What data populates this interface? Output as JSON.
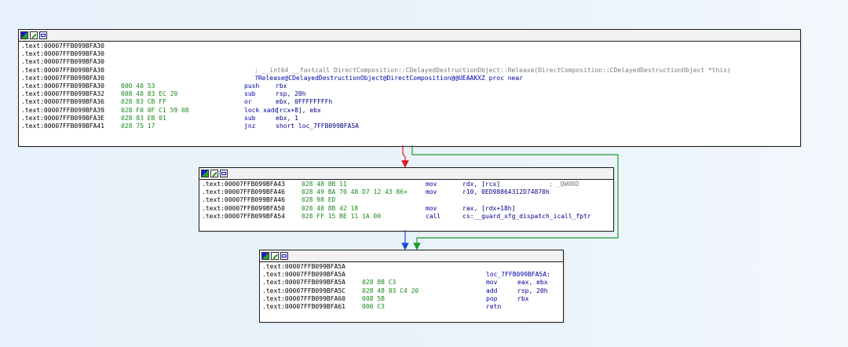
{
  "colors": {
    "background": "#e6f1fb",
    "edge_true": "#1f9a2e",
    "edge_false": "#e21a1a",
    "edge_uncond": "#1a4ad8"
  },
  "node_header_icons": [
    "color-picker-icon",
    "edit-node-icon",
    "graph-overview-icon"
  ],
  "blocks": [
    {
      "lines": [
        {
          "addr": ".text:00007FFB099BFA30",
          "bytes": "",
          "mnem": "",
          "ops": "",
          "comment": ""
        },
        {
          "addr": ".text:00007FFB099BFA30",
          "bytes": "",
          "mnem": "",
          "ops": "",
          "comment": ""
        },
        {
          "addr": ".text:00007FFB099BFA30",
          "bytes": "",
          "mnem": "",
          "ops": "",
          "comment": ""
        },
        {
          "addr": ".text:00007FFB099BFA30",
          "bytes": "",
          "mnem": "",
          "ops": "",
          "comment": "; __int64 __fastcall DirectComposition::CDelayedDestructionObject::Release(DirectComposition::CDelayedDestructionObject *this)"
        },
        {
          "addr": ".text:00007FFB099BFA30",
          "bytes": "",
          "mnem": "",
          "ops": "",
          "comment": "",
          "name": "?Release@CDelayedDestructionObject@DirectComposition@@UEAAKXZ proc near"
        },
        {
          "addr": ".text:00007FFB099BFA30",
          "bytes": "000 40 53",
          "mnem": "push",
          "ops": "rbx",
          "comment": ""
        },
        {
          "addr": ".text:00007FFB099BFA32",
          "bytes": "008 48 83 EC 20",
          "mnem": "sub",
          "ops": "rsp, 20h",
          "comment": ""
        },
        {
          "addr": ".text:00007FFB099BFA36",
          "bytes": "028 83 CB FF",
          "mnem": "or",
          "ops": "ebx, 0FFFFFFFFh",
          "comment": ""
        },
        {
          "addr": ".text:00007FFB099BFA39",
          "bytes": "028 F0 0F C1 59 08",
          "mnem": "lock xadd",
          "ops": "[rcx+8], ebx",
          "comment": ""
        },
        {
          "addr": ".text:00007FFB099BFA3E",
          "bytes": "028 83 EB 01",
          "mnem": "sub",
          "ops": "ebx, 1",
          "comment": ""
        },
        {
          "addr": ".text:00007FFB099BFA41",
          "bytes": "028 75 17",
          "mnem": "jnz",
          "ops": "short loc_7FFB099BFA5A",
          "comment": ""
        }
      ]
    },
    {
      "lines": [
        {
          "addr": ".text:00007FFB099BFA43",
          "bytes": "028 48 8B 11",
          "mnem": "mov",
          "ops": "rdx, [rcx]",
          "comment": "; _QWORD"
        },
        {
          "addr": ".text:00007FFB099BFA46",
          "bytes": "028 49 BA 70 48 D7 12 43 86+",
          "mnem": "mov",
          "ops": "r10, 0ED98864312D74870h",
          "comment": ""
        },
        {
          "addr": ".text:00007FFB099BFA46",
          "bytes": "028 98 ED",
          "mnem": "",
          "ops": "",
          "comment": ""
        },
        {
          "addr": ".text:00007FFB099BFA50",
          "bytes": "028 48 8B 42 18",
          "mnem": "mov",
          "ops": "rax, [rdx+18h]",
          "comment": ""
        },
        {
          "addr": ".text:00007FFB099BFA54",
          "bytes": "028 FF 15 BE 11 1A 00",
          "mnem": "call",
          "ops": "cs:__guard_xfg_dispatch_icall_fptr",
          "comment": ""
        }
      ]
    },
    {
      "lines": [
        {
          "addr": ".text:00007FFB099BFA5A",
          "bytes": "",
          "mnem": "",
          "ops": "",
          "comment": ""
        },
        {
          "addr": ".text:00007FFB099BFA5A",
          "bytes": "",
          "mnem": "",
          "ops": "",
          "comment": "",
          "name": "loc_7FFB099BFA5A:"
        },
        {
          "addr": ".text:00007FFB099BFA5A",
          "bytes": "028 8B C3",
          "mnem": "mov",
          "ops": "eax, ebx",
          "comment": ""
        },
        {
          "addr": ".text:00007FFB099BFA5C",
          "bytes": "028 48 83 C4 20",
          "mnem": "add",
          "ops": "rsp, 20h",
          "comment": ""
        },
        {
          "addr": ".text:00007FFB099BFA60",
          "bytes": "008 5B",
          "mnem": "pop",
          "ops": "rbx",
          "comment": ""
        },
        {
          "addr": ".text:00007FFB099BFA61",
          "bytes": "000 C3",
          "mnem": "retn",
          "ops": "",
          "comment": ""
        }
      ]
    }
  ]
}
